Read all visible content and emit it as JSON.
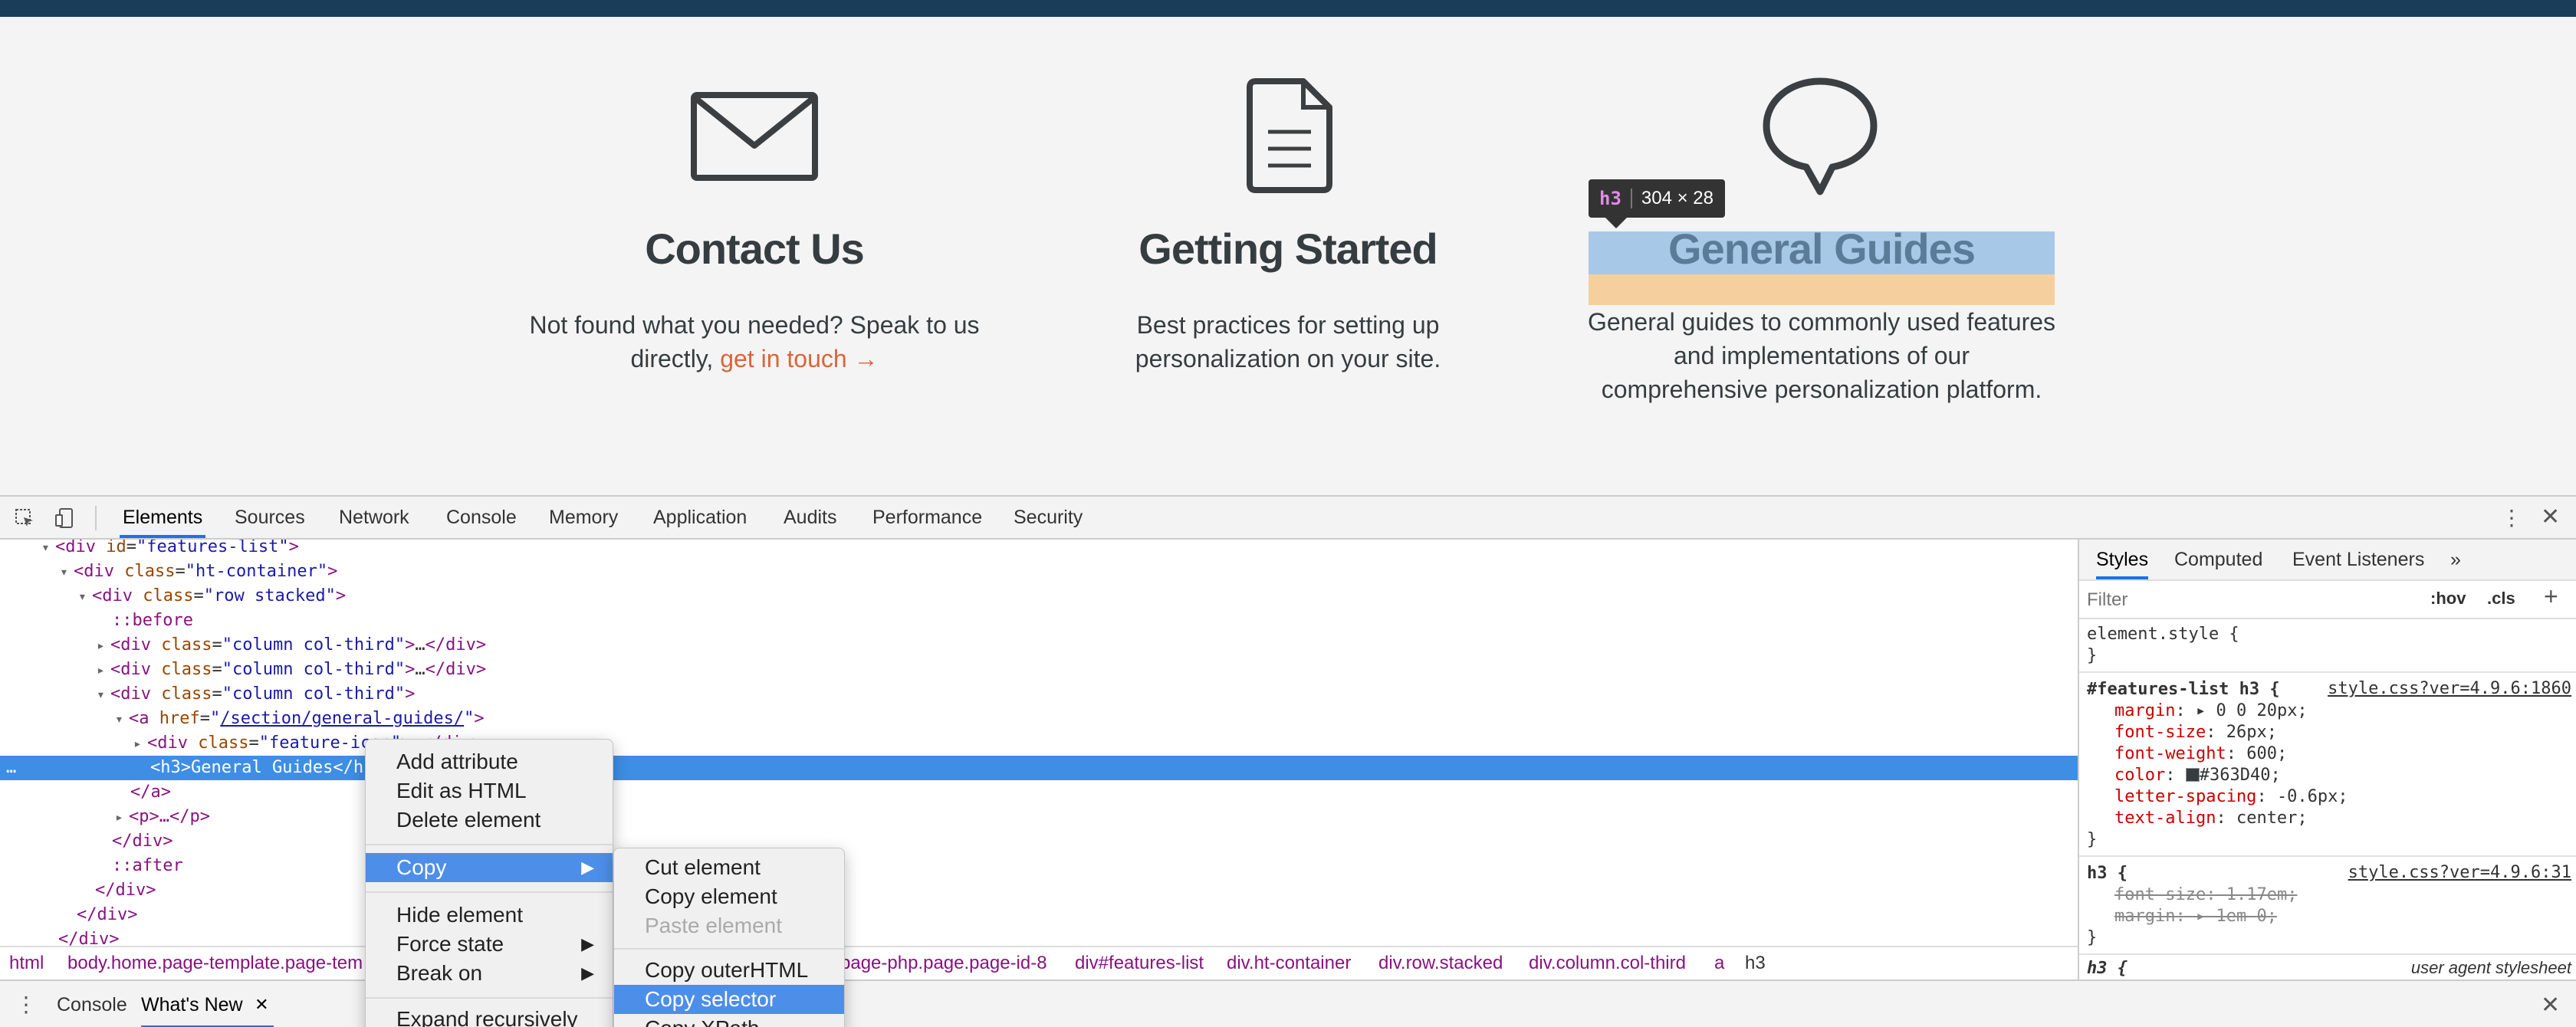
{
  "site": {
    "features": [
      {
        "title": "Contact Us",
        "desc_line1": "Not found what you needed? Speak to us",
        "desc_line2_prefix": "directly, ",
        "link": "get in touch →"
      },
      {
        "title": "Getting Started",
        "desc_line1": "Best practices for setting up",
        "desc_line2": "personalization on your site."
      },
      {
        "title": "General Guides",
        "desc_line1": "General guides to commonly used features",
        "desc_line2": "and implementations of our",
        "desc_line3": "comprehensive personalization platform."
      }
    ],
    "tooltip": {
      "tag": "h3",
      "size": "304 × 28"
    }
  },
  "devtools": {
    "tabs": [
      "Elements",
      "Sources",
      "Network",
      "Console",
      "Memory",
      "Application",
      "Audits",
      "Performance",
      "Security"
    ],
    "dom": {
      "l1_id": "features-list",
      "l2_class": "ht-container",
      "l3_class": "row stacked",
      "before": "::before",
      "col_class": "column col-third",
      "ellipsis": "…",
      "href": "/section/general-guides/",
      "feature_icon": "feature-icon",
      "h3_text": "<h3>General Guides</h",
      "a_close": "</a>",
      "p_line": "<p>…</p>",
      "div_close": "</div>",
      "after": "::after",
      "dots": "…"
    },
    "breadcrumb": [
      "html",
      "body.home.page-template.page-tem",
      "page-php.page.page-id-8",
      "div#features-list",
      "div.ht-container",
      "div.row.stacked",
      "div.column.col-third",
      "a",
      "h3"
    ],
    "styles": {
      "tabs": [
        "Styles",
        "Computed",
        "Event Listeners",
        "»"
      ],
      "filter_placeholder": "Filter",
      "hov": ":hov",
      "cls": ".cls",
      "element_style": "element.style {",
      "close_brace": "}",
      "rule1_selector": "#features-list h3 {",
      "rule1_source": "style.css?ver=4.9.6:1860",
      "rule1": [
        {
          "prop": "margin",
          "val": "▸ 0 0 20px;"
        },
        {
          "prop": "font-size",
          "val": "26px;"
        },
        {
          "prop": "font-weight",
          "val": "600;"
        },
        {
          "prop": "color",
          "val": "#363D40;"
        },
        {
          "prop": "letter-spacing",
          "val": "-0.6px;"
        },
        {
          "prop": "text-align",
          "val": "center;"
        }
      ],
      "rule2_selector": "h3 {",
      "rule2_source": "style.css?ver=4.9.6:31",
      "rule2": [
        {
          "prop": "font-size",
          "val": "1.17em;"
        },
        {
          "prop": "margin",
          "val": "▸ 1em 0;"
        }
      ],
      "rule3_selector": "h3 {",
      "rule3_source": "user agent stylesheet",
      "color_swatch": "#363D40"
    },
    "drawer_tabs": [
      "Console",
      "What's New"
    ]
  },
  "context_menu": {
    "items": [
      "Add attribute",
      "Edit as HTML",
      "Delete element",
      "Copy",
      "Hide element",
      "Force state",
      "Break on",
      "Expand recursively"
    ],
    "submenu": [
      "Cut element",
      "Copy element",
      "Paste element",
      "Copy outerHTML",
      "Copy selector",
      "Copy XPath"
    ]
  }
}
